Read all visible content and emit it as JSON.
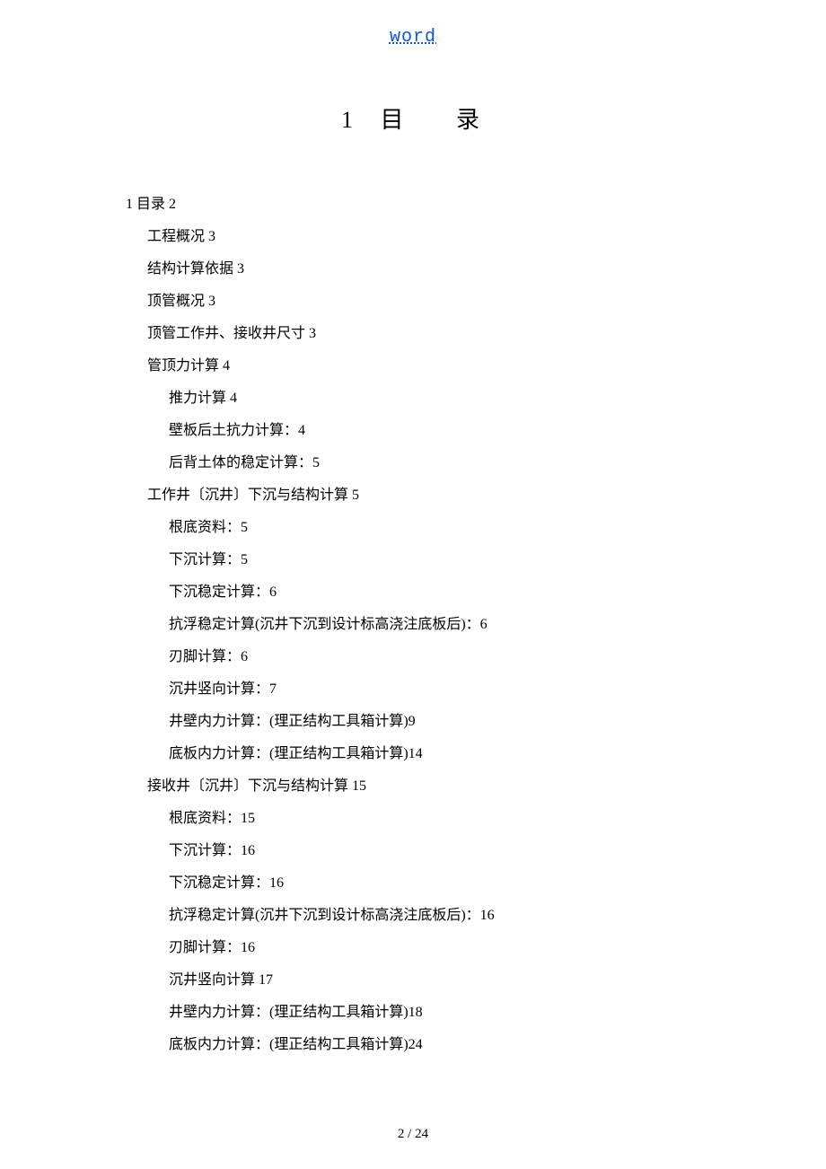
{
  "header": {
    "link_text": "word"
  },
  "title": {
    "number": "1",
    "char1": "目",
    "char2": "录"
  },
  "toc": [
    {
      "level": 0,
      "text": "1 目录 2"
    },
    {
      "level": 1,
      "text": "工程概况 3"
    },
    {
      "level": 1,
      "text": "结构计算依据 3"
    },
    {
      "level": 1,
      "text": "顶管概况 3"
    },
    {
      "level": 1,
      "text": "顶管工作井、接收井尺寸 3"
    },
    {
      "level": 1,
      "text": "管顶力计算 4"
    },
    {
      "level": 2,
      "text": "推力计算 4"
    },
    {
      "level": 2,
      "text": "壁板后土抗力计算：4"
    },
    {
      "level": 2,
      "text": "后背土体的稳定计算：5"
    },
    {
      "level": 1,
      "text": "工作井〔沉井〕下沉与结构计算 5"
    },
    {
      "level": 2,
      "text": "根底资料：5"
    },
    {
      "level": 2,
      "text": "下沉计算：5"
    },
    {
      "level": 2,
      "text": "下沉稳定计算：6"
    },
    {
      "level": 2,
      "text": "抗浮稳定计算(沉井下沉到设计标高浇注底板后)：6"
    },
    {
      "level": 2,
      "text": "刃脚计算：6"
    },
    {
      "level": 2,
      "text": "沉井竖向计算：7"
    },
    {
      "level": 2,
      "text": "井壁内力计算：(理正结构工具箱计算)9"
    },
    {
      "level": 2,
      "text": "底板内力计算：(理正结构工具箱计算)14"
    },
    {
      "level": 1,
      "text": "接收井〔沉井〕下沉与结构计算 15"
    },
    {
      "level": 2,
      "text": "根底资料：15"
    },
    {
      "level": 2,
      "text": "下沉计算：16"
    },
    {
      "level": 2,
      "text": "下沉稳定计算：16"
    },
    {
      "level": 2,
      "text": "抗浮稳定计算(沉井下沉到设计标高浇注底板后)：16"
    },
    {
      "level": 2,
      "text": "刃脚计算：16"
    },
    {
      "level": 2,
      "text": "沉井竖向计算 17"
    },
    {
      "level": 2,
      "text": "井壁内力计算：(理正结构工具箱计算)18"
    },
    {
      "level": 2,
      "text": "底板内力计算：(理正结构工具箱计算)24"
    }
  ],
  "footer": {
    "page_indicator": "2 / 24"
  }
}
